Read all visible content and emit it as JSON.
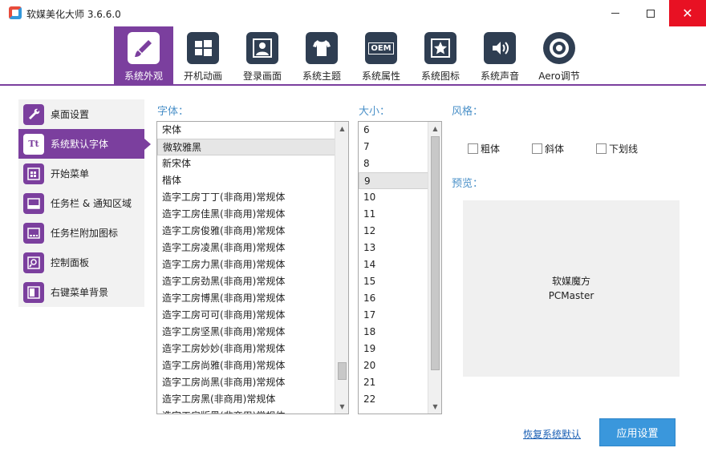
{
  "window": {
    "title": "软媒美化大师 3.6.6.0"
  },
  "toolbar": {
    "items": [
      {
        "label": "系统外观",
        "icon": "brush-icon"
      },
      {
        "label": "开机动画",
        "icon": "windows-logo-icon"
      },
      {
        "label": "登录画面",
        "icon": "user-icon"
      },
      {
        "label": "系统主题",
        "icon": "tshirt-icon"
      },
      {
        "label": "系统属性",
        "icon": "oem-icon"
      },
      {
        "label": "系统图标",
        "icon": "star-icon"
      },
      {
        "label": "系统声音",
        "icon": "speaker-icon"
      },
      {
        "label": "Aero调节",
        "icon": "aero-icon"
      }
    ],
    "oem_text": "OEM"
  },
  "sidebar": {
    "items": [
      {
        "label": "桌面设置",
        "icon": "wrench-icon"
      },
      {
        "label": "系统默认字体",
        "icon": "font-icon",
        "icon_text": "Tt"
      },
      {
        "label": "开始菜单",
        "icon": "start-menu-icon"
      },
      {
        "label": "任务栏 & 通知区域",
        "icon": "taskbar-icon"
      },
      {
        "label": "任务栏附加图标",
        "icon": "taskbar-extra-icon"
      },
      {
        "label": "控制面板",
        "icon": "control-panel-icon"
      },
      {
        "label": "右键菜单背景",
        "icon": "context-menu-icon"
      }
    ]
  },
  "font": {
    "label": "字体：",
    "items": [
      "宋体",
      "微软雅黑",
      "新宋体",
      "楷体",
      "造字工房丁丁(非商用)常规体",
      "造字工房佳黑(非商用)常规体",
      "造字工房俊雅(非商用)常规体",
      "造字工房凌黑(非商用)常规体",
      "造字工房力黑(非商用)常规体",
      "造字工房劲黑(非商用)常规体",
      "造字工房博黑(非商用)常规体",
      "造字工房可可(非商用)常规体",
      "造字工房坚黑(非商用)常规体",
      "造字工房妙妙(非商用)常规体",
      "造字工房尚雅(非商用)常规体",
      "造字工房尚黑(非商用)常规体",
      "造字工房黑(非商用)常规体",
      "造字工房版黑(非商用)常规体"
    ],
    "selected": "微软雅黑"
  },
  "size": {
    "label": "大小：",
    "items": [
      "6",
      "7",
      "8",
      "9",
      "10",
      "11",
      "12",
      "13",
      "14",
      "15",
      "16",
      "17",
      "18",
      "19",
      "20",
      "21",
      "22"
    ],
    "selected": "9"
  },
  "style": {
    "label": "风格：",
    "options": [
      {
        "label": "粗体",
        "checked": false
      },
      {
        "label": "斜体",
        "checked": false
      },
      {
        "label": "下划线",
        "checked": false
      }
    ]
  },
  "preview": {
    "label": "预览：",
    "line1": "软媒魔方",
    "line2": "PCMaster"
  },
  "actions": {
    "reset": "恢复系统默认",
    "apply": "应用设置"
  },
  "colors": {
    "accent": "#7b3f9e",
    "link": "#4a90c8",
    "button": "#3a97dc"
  }
}
